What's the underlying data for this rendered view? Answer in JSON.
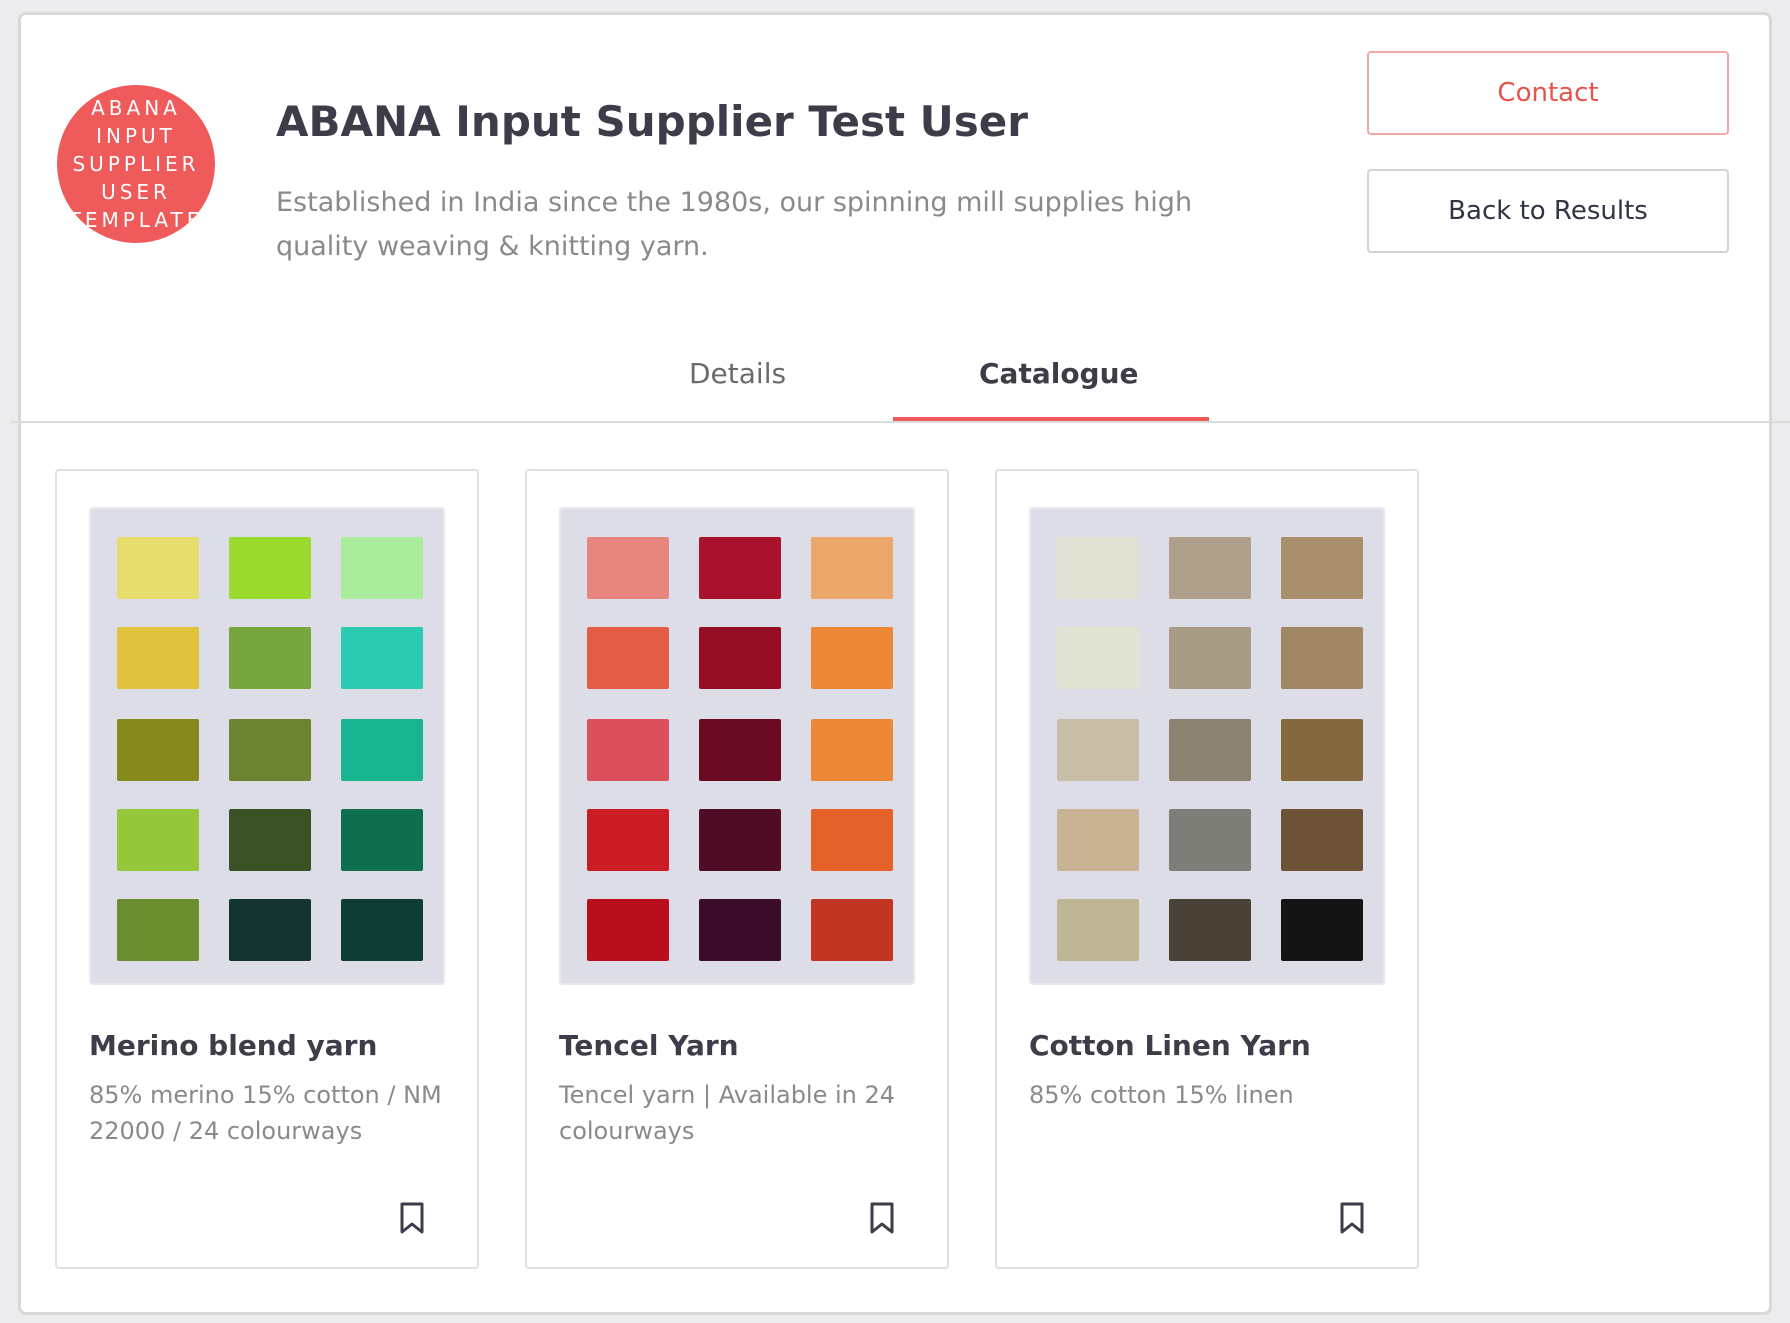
{
  "profile": {
    "logo_lines": [
      "ABANA",
      "INPUT",
      "SUPPLIER",
      "USER",
      "TEMPLATE"
    ],
    "name": "ABANA Input Supplier Test User",
    "description": "Established in India since the 1980s, our spinning mill supplies high quality weaving & knitting yarn."
  },
  "actions": {
    "contact_label": "Contact",
    "back_label": "Back to Results"
  },
  "tabs": [
    {
      "label": "Details",
      "active": false
    },
    {
      "label": "Catalogue",
      "active": true
    }
  ],
  "colors": {
    "accent": "#ef5a5a",
    "title": "#3d3d4a",
    "muted": "#8a8a8a"
  },
  "catalogue": [
    {
      "title": "Merino blend yarn",
      "description": "85% merino 15% cotton / NM 22000 / 24 colourways",
      "bookmark_icon": "bookmark-icon",
      "swatches": [
        [
          "#e6dc6c",
          "#9ad92e",
          "#a8ec9c"
        ],
        [
          "#e0c23c",
          "#78a63e",
          "#2ccab0"
        ],
        [
          "#868a1c",
          "#6c8430",
          "#18b490"
        ],
        [
          "#96c63a",
          "#3a5226",
          "#0e6e4e"
        ],
        [
          "#6a8e30",
          "#143432",
          "#0c3c34"
        ]
      ]
    },
    {
      "title": "Tencel Yarn",
      "description": "Tencel yarn | Available in 24 colourways",
      "bookmark_icon": "bookmark-icon",
      "swatches": [
        [
          "#e8847e",
          "#a8122c",
          "#eca66a"
        ],
        [
          "#e45c46",
          "#960e24",
          "#ec8838"
        ],
        [
          "#dc505e",
          "#6a0a22",
          "#ec8836"
        ],
        [
          "#cc1c24",
          "#4e0c26",
          "#e4622a"
        ],
        [
          "#b80e1e",
          "#3a0c2a",
          "#c03622"
        ]
      ]
    },
    {
      "title": "Cotton Linen Yarn",
      "description": "85% cotton 15% linen",
      "bookmark_icon": "bookmark-icon",
      "swatches": [
        [
          "#e2e0d2",
          "#aea08a",
          "#a88e6a"
        ],
        [
          "#e0e2d2",
          "#a89c86",
          "#a08866"
        ],
        [
          "#c8bea8",
          "#8c8272",
          "#86683e"
        ],
        [
          "#c8b494",
          "#7e7e78",
          "#6e5238"
        ],
        [
          "#beb594",
          "#4a4236",
          "#141414"
        ]
      ]
    }
  ]
}
